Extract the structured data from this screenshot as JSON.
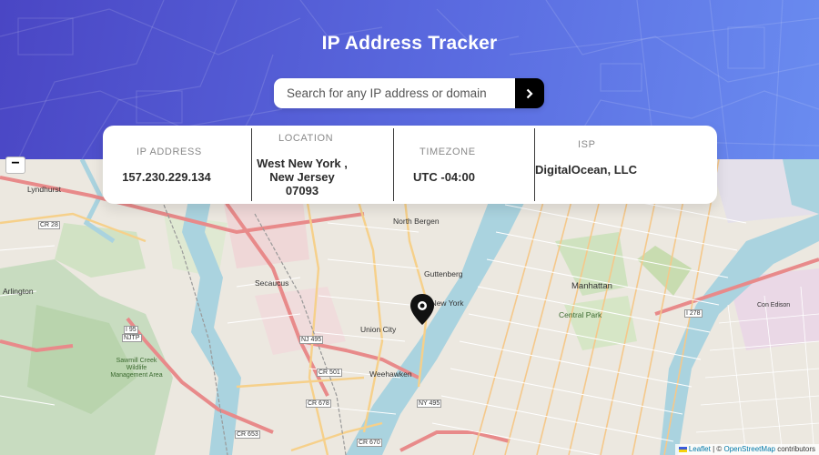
{
  "header": {
    "title": "IP Address Tracker",
    "background_start": "#4a46c4",
    "background_end": "#6a8cf0"
  },
  "search": {
    "placeholder": "Search for any IP address or domain",
    "value": "",
    "submit_icon": "chevron-right-icon"
  },
  "info": {
    "ip": {
      "label": "IP Address",
      "value": "157.230.229.134"
    },
    "location": {
      "label": "Location",
      "value": "West New York , New Jersey 07093"
    },
    "timezone": {
      "label": "Timezone",
      "value": "UTC -04:00"
    },
    "isp": {
      "label": "ISP",
      "value": "DigitalOcean, LLC"
    }
  },
  "map": {
    "zoom_out_label": "−",
    "marker_icon": "location-pin-icon",
    "attribution": {
      "leaflet": "Leaflet",
      "separator": " | © ",
      "osm": "OpenStreetMap",
      "suffix": " contributors"
    },
    "labels": {
      "lyndhurst": "Lyndhurst",
      "north_bergen": "North Bergen",
      "guttenberg": "Guttenberg",
      "secaucus": "Secaucus",
      "west_new_york": "West New York",
      "union_city": "Union City",
      "weehawken": "Weehawken",
      "manhattan": "Manhattan",
      "central_park": "Central Park",
      "arlington": "Arlington",
      "con_edison": "Con Edison",
      "cr28": "CR 28",
      "cr501": "CR 501",
      "cr653": "CR 653",
      "cr670": "CR 670",
      "cr678": "CR 678",
      "nj495": "NJ 495",
      "ny495": "NY 495",
      "i278": "I 278",
      "i95": "I 95",
      "njtp": "NJTP",
      "sawmill": "Sawmill Creek Wildlife Management Area"
    }
  }
}
